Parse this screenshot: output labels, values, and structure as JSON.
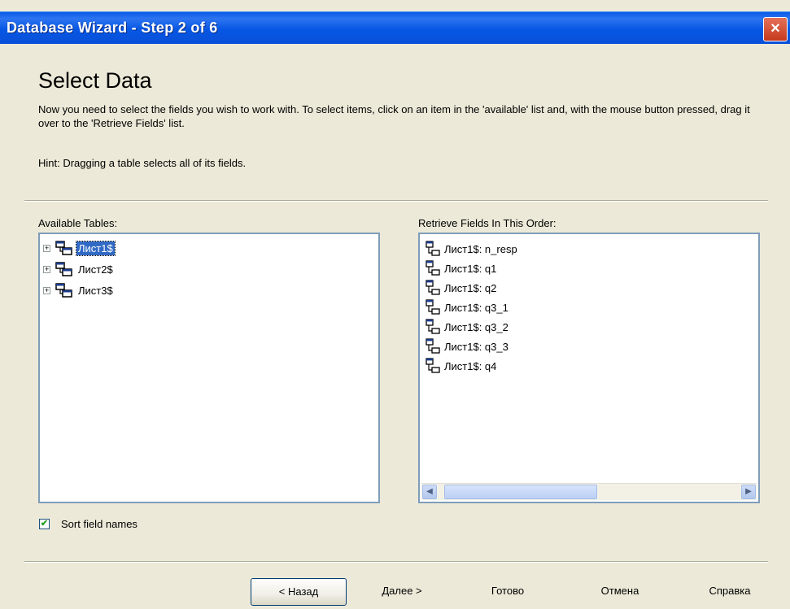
{
  "window": {
    "title": "Database Wizard - Step 2 of 6",
    "close_symbol": "×"
  },
  "header": {
    "title": "Select Data",
    "description": "Now you need to select the fields you wish to work with. To select items, click on an item in the 'available' list and, with the mouse button pressed, drag it over to the 'Retrieve Fields' list.",
    "hint": "Hint: Dragging a table selects all of its fields."
  },
  "available": {
    "label": "Available Tables:",
    "tables": [
      {
        "name": "Лист1$",
        "selected": true
      },
      {
        "name": "Лист2$",
        "selected": false
      },
      {
        "name": "Лист3$",
        "selected": false
      }
    ]
  },
  "retrieve": {
    "label": "Retrieve Fields In This Order:",
    "fields": [
      "Лист1$: n_resp",
      "Лист1$: q1",
      "Лист1$: q2",
      "Лист1$: q3_1",
      "Лист1$: q3_2",
      "Лист1$: q3_3",
      "Лист1$: q4"
    ]
  },
  "options": {
    "sort_label": "Sort field names",
    "sort_checked": true
  },
  "buttons": {
    "back": "< Назад",
    "next": "Далее >",
    "finish": "Готово",
    "cancel": "Отмена",
    "help": "Справка"
  }
}
